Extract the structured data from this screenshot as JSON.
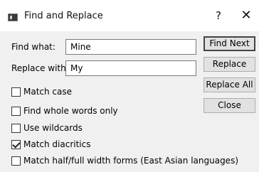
{
  "window": {
    "title": "Find and Replace",
    "help_label": "?",
    "close_label": "✕",
    "app_icon": "window-icon"
  },
  "find": {
    "label": "Find what:",
    "value": "Mine"
  },
  "replace": {
    "label": "Replace with:",
    "value": "My"
  },
  "buttons": {
    "find_next": "Find Next",
    "replace": "Replace",
    "replace_all": "Replace All",
    "close": "Close"
  },
  "options": [
    {
      "label": "Match case",
      "checked": false
    },
    {
      "label": "Find whole words only",
      "checked": false
    },
    {
      "label": "Use wildcards",
      "checked": false
    },
    {
      "label": "Match diacritics",
      "checked": true
    },
    {
      "label": "Match half/full width forms (East Asian languages)",
      "checked": false
    }
  ]
}
